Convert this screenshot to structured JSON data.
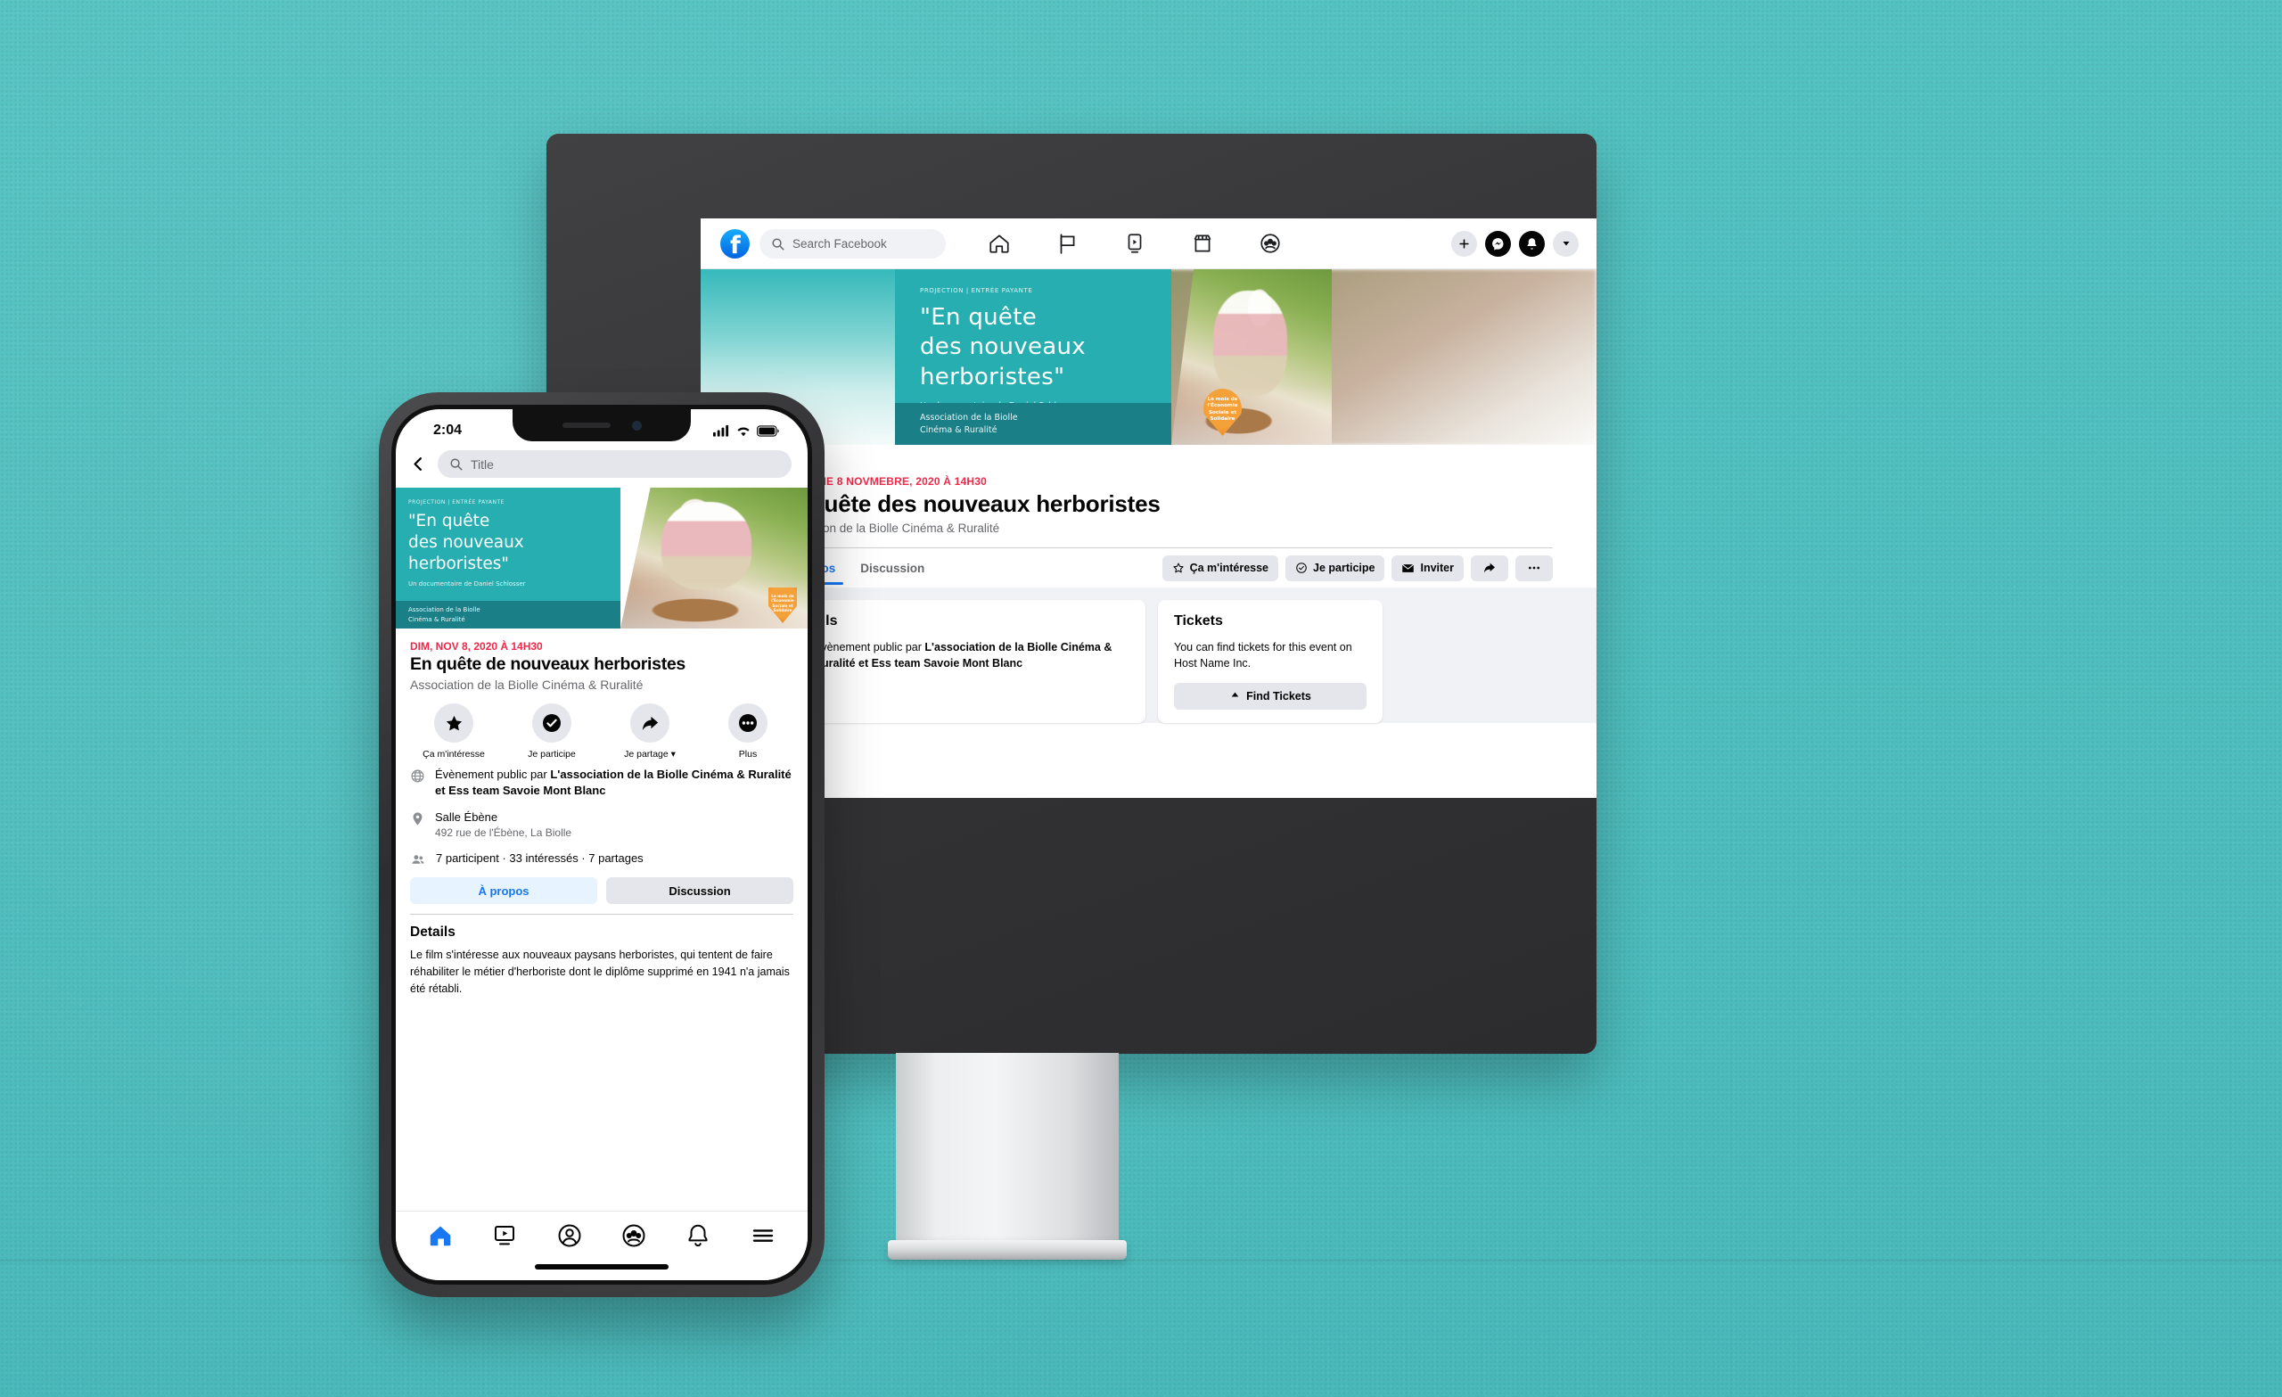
{
  "background": {
    "color": "#4FC0C0"
  },
  "desktop": {
    "topbar": {
      "logo_letter": "f",
      "search_placeholder": "Search Facebook",
      "nav_icons": [
        "home-icon",
        "flag-icon",
        "watch-icon",
        "marketplace-icon",
        "groups-icon"
      ],
      "right_icons": [
        "plus-icon",
        "messenger-icon",
        "bell-icon",
        "chevron-down-icon"
      ]
    },
    "cover": {
      "kicker": "PROJECTION | ENTRÉE PAYANTE",
      "title_line1": "\"En quête",
      "title_line2": "des nouveaux",
      "title_line3": "herboristes\"",
      "subtitle": "Un documentaire de Daniel Schlosser",
      "band_line1": "Association de la Biolle",
      "band_line2": "Cinéma & Ruralité",
      "badge_text": "Le mois de l'Économie Sociale et Solidaire",
      "calendar_day": "8"
    },
    "event": {
      "date": "DIMANCHE 8 NOVMEBRE, 2020 À 14H30",
      "title": "En quête des nouveaux herboristes",
      "host": "Association de la Biolle Cinéma & Ruralité",
      "tabs": [
        {
          "label": "À propos",
          "active": true
        },
        {
          "label": "Discussion",
          "active": false
        }
      ],
      "actions": [
        {
          "label": "Ça m'intéresse",
          "icon": "star-outline-icon"
        },
        {
          "label": "Je participe",
          "icon": "check-circle-icon"
        },
        {
          "label": "Inviter",
          "icon": "envelope-icon"
        },
        {
          "label": "",
          "icon": "share-icon"
        },
        {
          "label": "",
          "icon": "ellipsis-icon"
        }
      ]
    },
    "cards": {
      "details": {
        "heading": "Détails",
        "icon": "globe-icon",
        "line_prefix": "Évènement public par ",
        "line_bold": "L'association de la Biolle Cinéma & Ruralité et Ess team Savoie Mont Blanc"
      },
      "tickets": {
        "heading": "Tickets",
        "body": "You can find tickets for this event on Host Name Inc.",
        "button_label": "Find Tickets"
      }
    }
  },
  "phone": {
    "status": {
      "time": "2:04",
      "icons": [
        "cellular-icon",
        "wifi-icon",
        "battery-icon"
      ]
    },
    "search": {
      "back_icon": "back-chevron-icon",
      "placeholder": "Title"
    },
    "cover": {
      "kicker": "PROJECTION | ENTRÉE PAYANTE",
      "title_line1": "\"En quête",
      "title_line2": "des nouveaux",
      "title_line3": "herboristes\"",
      "subtitle": "Un documentaire de Daniel Schlosser",
      "band_line1": "Association de la Biolle",
      "band_line2": "Cinéma & Ruralité",
      "badge_text": "Le mois de l'Économie Sociale et Solidaire"
    },
    "event": {
      "date": "DIM, NOV 8, 2020 À 14H30",
      "title": "En quête de nouveaux herboristes",
      "host": "Association de la Biolle Cinéma & Ruralité"
    },
    "actions": [
      {
        "label": "Ça m'intéresse",
        "icon": "star-filled-icon"
      },
      {
        "label": "Je participe",
        "icon": "check-circle-filled-icon"
      },
      {
        "label": "Je partage ▾",
        "icon": "share-icon"
      },
      {
        "label": "Plus",
        "icon": "ellipsis-circle-icon"
      }
    ],
    "info": {
      "public_prefix": "Évènement public par ",
      "public_bold": "L'association de la Biolle Cinéma & Ruralité et Ess team Savoie Mont Blanc",
      "venue_name": "Salle Ébène",
      "venue_address": "492 rue de l'Ébène, La Biolle",
      "stats": "7 participent · 33 intéressés · 7 partages"
    },
    "segments": [
      {
        "label": "À propos",
        "active": true
      },
      {
        "label": "Discussion",
        "active": false
      }
    ],
    "details": {
      "heading": "Details",
      "body": "Le film s'intéresse aux nouveaux paysans herboristes, qui tentent de faire réhabiliter le métier d'herboriste dont le diplôme supprimé en 1941 n'a jamais été rétabli."
    },
    "tabbar": [
      "home-icon",
      "watch-icon",
      "profile-icon",
      "groups-icon",
      "bell-icon",
      "menu-icon"
    ]
  }
}
